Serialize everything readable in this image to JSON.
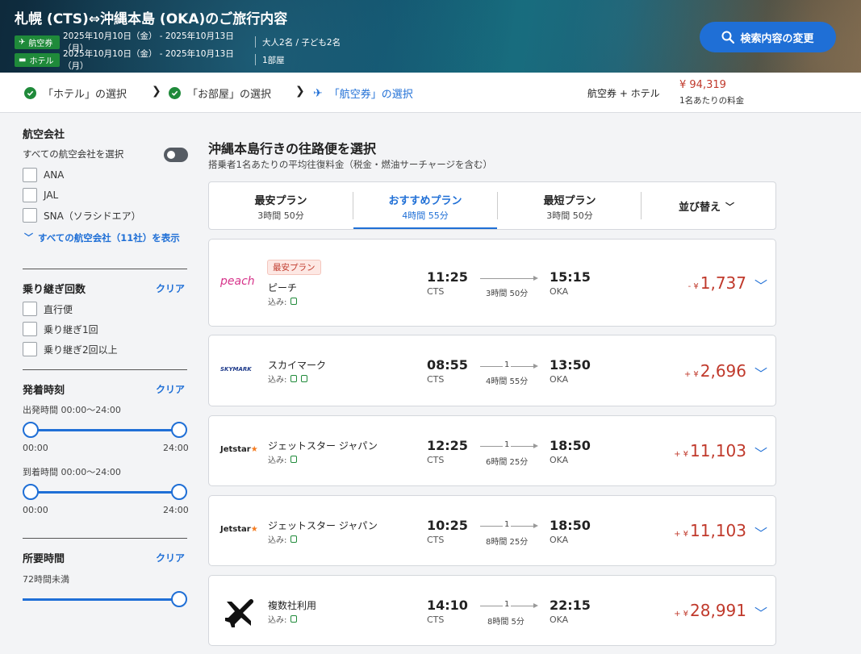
{
  "header": {
    "title": "札幌 (CTS)⇔沖縄本島 (OKA)のご旅行内容",
    "rows": [
      {
        "tag": "航空券",
        "dates": "2025年10月10日（金） - 2025年10月13日（月）",
        "detail": "大人2名 / 子ども2名"
      },
      {
        "tag": "ホテル",
        "dates": "2025年10月10日（金） - 2025年10月13日（月）",
        "detail": "1部屋"
      }
    ],
    "search_button": "検索内容の変更"
  },
  "breadcrumbs": {
    "step1": "「ホテル」の選択",
    "step2": "「お部屋」の選択",
    "step3": "「航空券」の選択",
    "summary_label": "航空券 + ホテル",
    "summary_price": "¥ 94,319",
    "summary_sub": "1名あたりの料金"
  },
  "sidebar": {
    "airline": {
      "heading": "航空会社",
      "select_all": "すべての航空会社を選択",
      "options": [
        "ANA",
        "JAL",
        "SNA（ソラシドエア）"
      ],
      "show_all": "すべての航空会社（11社）を表示"
    },
    "stops": {
      "heading": "乗り継ぎ回数",
      "clear": "クリア",
      "options": [
        "直行便",
        "乗り継ぎ1回",
        "乗り継ぎ2回以上"
      ]
    },
    "time": {
      "heading": "発着時刻",
      "clear": "クリア",
      "depart_label": "出発時間 00:00～24:00",
      "arrive_label": "到着時間 00:00～24:00",
      "min": "00:00",
      "max": "24:00"
    },
    "duration": {
      "heading": "所要時間",
      "clear": "クリア",
      "label": "72時間未満"
    }
  },
  "main": {
    "title": "沖縄本島行きの往路便を選択",
    "subtitle": "搭乗者1名あたりの平均往復料金（税金・燃油サーチャージを含む）",
    "tabs": [
      {
        "label": "最安プラン",
        "sub": "3時間 50分"
      },
      {
        "label": "おすすめプラン",
        "sub": "4時間 55分"
      },
      {
        "label": "最短プラン",
        "sub": "3時間 50分"
      }
    ],
    "sort_label": "並び替え",
    "flights": [
      {
        "logo": "peach",
        "badge": "最安プラン",
        "airline": "ピーチ",
        "included": "込み:",
        "dep": "11:25",
        "dep_ap": "CTS",
        "arr": "15:15",
        "arr_ap": "OKA",
        "stops": "",
        "duration": "3時間 50分",
        "sign": "- ¥",
        "price": "1,737"
      },
      {
        "logo": "SKYMARK",
        "badge": "",
        "airline": "スカイマーク",
        "included": "込み:",
        "dep": "08:55",
        "dep_ap": "CTS",
        "arr": "13:50",
        "arr_ap": "OKA",
        "stops": "1",
        "duration": "4時間 55分",
        "sign": "+ ¥",
        "price": "2,696"
      },
      {
        "logo": "Jetstar",
        "badge": "",
        "airline": "ジェットスター ジャパン",
        "included": "込み:",
        "dep": "12:25",
        "dep_ap": "CTS",
        "arr": "18:50",
        "arr_ap": "OKA",
        "stops": "1",
        "duration": "6時間 25分",
        "sign": "+ ¥",
        "price": "11,103"
      },
      {
        "logo": "Jetstar",
        "badge": "",
        "airline": "ジェットスター ジャパン",
        "included": "込み:",
        "dep": "10:25",
        "dep_ap": "CTS",
        "arr": "18:50",
        "arr_ap": "OKA",
        "stops": "1",
        "duration": "8時間 25分",
        "sign": "+ ¥",
        "price": "11,103"
      },
      {
        "logo": "plane-icon",
        "badge": "",
        "airline": "複数社利用",
        "included": "込み:",
        "dep": "14:10",
        "dep_ap": "CTS",
        "arr": "22:15",
        "arr_ap": "OKA",
        "stops": "1",
        "duration": "8時間 5分",
        "sign": "+ ¥",
        "price": "28,991"
      }
    ]
  },
  "colors": {
    "accent": "#1f6fd6",
    "price": "#c0392b",
    "success": "#1f8a3a"
  }
}
